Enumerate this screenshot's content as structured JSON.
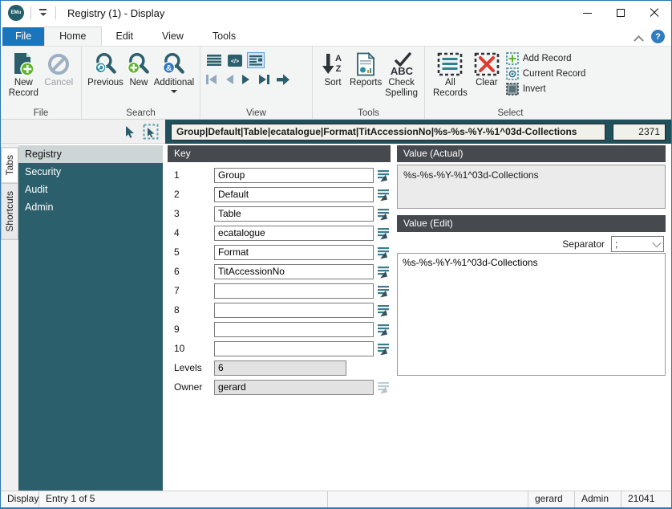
{
  "colors": {
    "teal": "#2b5f6b",
    "teal-dark": "#1f505c",
    "sidebar-teal": "#2a5f6b",
    "header-gray": "#46494d",
    "file-tab-blue": "#1b75bb",
    "green": "#5cb52a",
    "red": "#df3a2e",
    "help-blue": "#2f7cc0",
    "disabled-gray": "#9db0c2"
  },
  "window": {
    "logo_text": "EMu",
    "title": "Registry (1) - Display"
  },
  "ribbon": {
    "tabs": [
      {
        "label": "File"
      },
      {
        "label": "Home"
      },
      {
        "label": "Edit"
      },
      {
        "label": "View"
      },
      {
        "label": "Tools"
      }
    ],
    "active_tab": "Home",
    "help_glyph": "?",
    "groups": {
      "file": {
        "label": "File",
        "new_record": "New\nRecord",
        "cancel": "Cancel"
      },
      "search": {
        "label": "Search",
        "previous": "Previous",
        "new": "New",
        "additional": "Additional"
      },
      "view": {
        "label": "View",
        "code_glyph": "</>"
      },
      "tools": {
        "label": "Tools",
        "sort": "Sort",
        "reports": "Reports",
        "check_spelling": "Check\nSpelling",
        "sort_a": "A",
        "sort_z": "Z",
        "abc": "ABC"
      },
      "select": {
        "label": "Select",
        "all_records": "All\nRecords",
        "clear": "Clear",
        "add_record": "Add Record",
        "current_record": "Current Record",
        "invert": "Invert"
      }
    }
  },
  "pathbar": {
    "path": "Group|Default|Table|ecatalogue|Format|TitAccessionNo|%s-%s-%Y-%1^03d-Collections",
    "count": "2371"
  },
  "sidebar": {
    "tabs": [
      {
        "label": "Tabs"
      },
      {
        "label": "Shortcuts"
      }
    ],
    "active_tab": "Tabs",
    "items": [
      {
        "label": "Registry"
      },
      {
        "label": "Security"
      },
      {
        "label": "Audit"
      },
      {
        "label": "Admin"
      }
    ],
    "active_item": "Registry"
  },
  "key_panel": {
    "header": "Key",
    "rows": [
      {
        "num": "1",
        "value": "Group"
      },
      {
        "num": "2",
        "value": "Default"
      },
      {
        "num": "3",
        "value": "Table"
      },
      {
        "num": "4",
        "value": "ecatalogue"
      },
      {
        "num": "5",
        "value": "Format"
      },
      {
        "num": "6",
        "value": "TitAccessionNo"
      },
      {
        "num": "7",
        "value": ""
      },
      {
        "num": "8",
        "value": ""
      },
      {
        "num": "9",
        "value": ""
      },
      {
        "num": "10",
        "value": ""
      }
    ],
    "levels_label": "Levels",
    "levels_value": "6",
    "owner_label": "Owner",
    "owner_value": "gerard"
  },
  "value_panel": {
    "actual_header": "Value (Actual)",
    "actual_value": "%s-%s-%Y-%1^03d-Collections",
    "edit_header": "Value (Edit)",
    "separator_label": "Separator",
    "separator_value": ";",
    "edit_value": "%s-%s-%Y-%1^03d-Collections"
  },
  "statusbar": {
    "mode": "Display",
    "entry": "Entry 1 of 5",
    "user": "gerard",
    "group": "Admin",
    "record": "21041"
  }
}
